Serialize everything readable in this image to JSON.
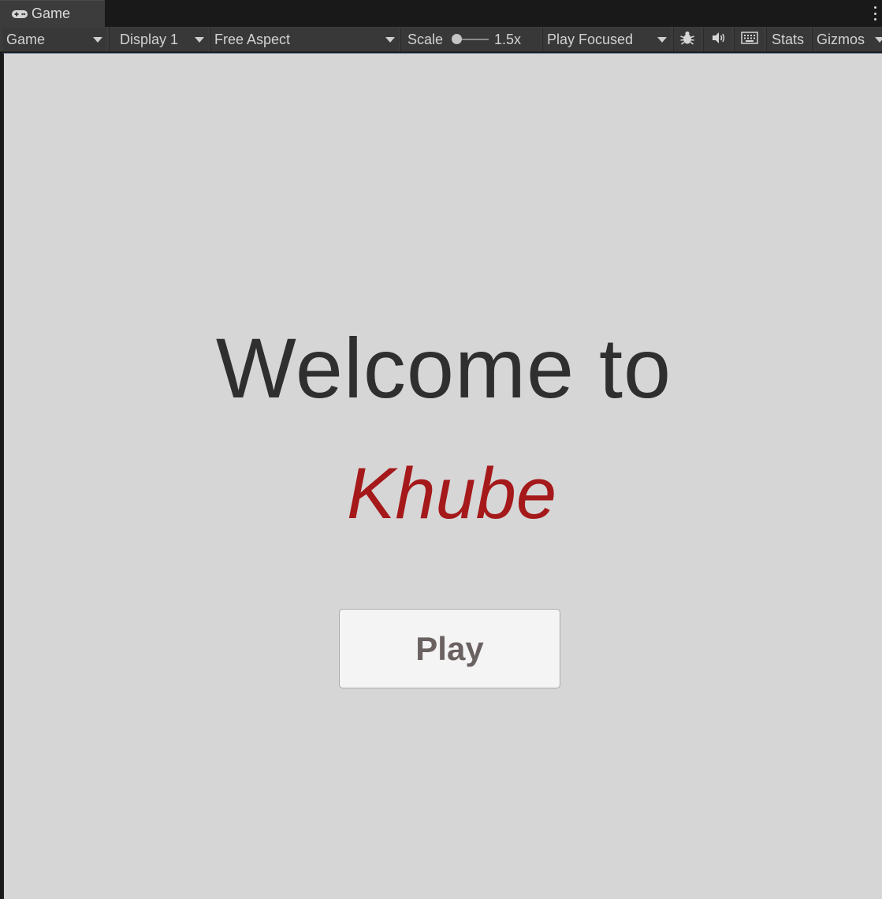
{
  "tab": {
    "title": "Game",
    "icon": "gamepad-icon"
  },
  "toolbar": {
    "view_label": "Game",
    "display_label": "Display 1",
    "aspect_label": "Free Aspect",
    "scale_label": "Scale",
    "scale_value": "1.5x",
    "play_mode_label": "Play Focused",
    "stats_label": "Stats",
    "gizmos_label": "Gizmos",
    "icons": [
      "bug-icon",
      "speaker-icon",
      "keyboard-icon"
    ]
  },
  "game": {
    "heading": "Welcome to",
    "brand": "Khube",
    "play_label": "Play",
    "brand_color": "#a5191b",
    "background_color": "#d6d6d6"
  }
}
